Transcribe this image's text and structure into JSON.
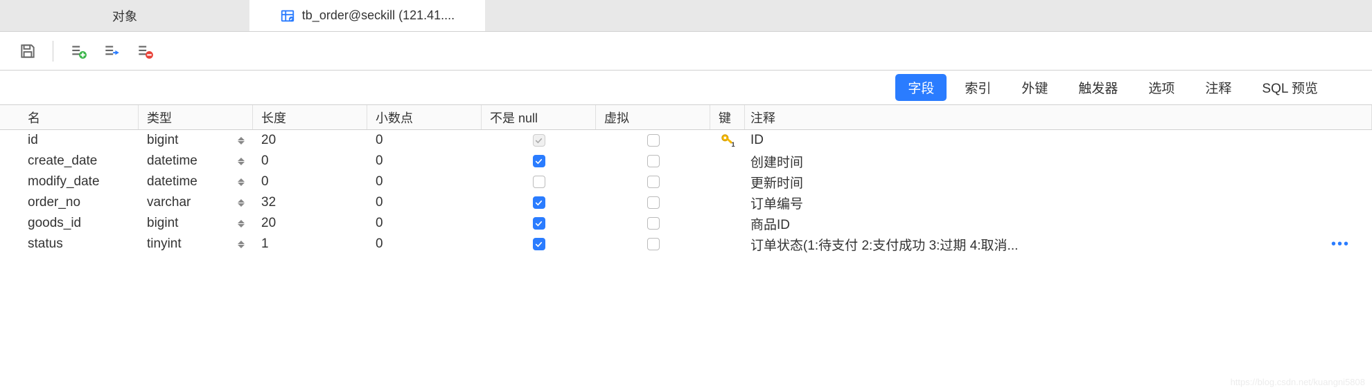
{
  "tabs": {
    "objects": "对象",
    "active": "tb_order@seckill (121.41...."
  },
  "subnav": {
    "items": [
      "字段",
      "索引",
      "外键",
      "触发器",
      "选项",
      "注释",
      "SQL 预览"
    ],
    "active_index": 0
  },
  "table": {
    "headers": {
      "name": "名",
      "type": "类型",
      "length": "长度",
      "decimal": "小数点",
      "not_null": "不是 null",
      "virtual": "虚拟",
      "key": "键",
      "comment": "注释"
    },
    "rows": [
      {
        "name": "id",
        "type": "bigint",
        "length": "20",
        "decimal": "0",
        "not_null": "disabled",
        "virtual": false,
        "key": true,
        "comment": "ID"
      },
      {
        "name": "create_date",
        "type": "datetime",
        "length": "0",
        "decimal": "0",
        "not_null": true,
        "virtual": false,
        "key": false,
        "comment": "创建时间"
      },
      {
        "name": "modify_date",
        "type": "datetime",
        "length": "0",
        "decimal": "0",
        "not_null": false,
        "virtual": false,
        "key": false,
        "comment": "更新时间"
      },
      {
        "name": "order_no",
        "type": "varchar",
        "length": "32",
        "decimal": "0",
        "not_null": true,
        "virtual": false,
        "key": false,
        "comment": "订单编号"
      },
      {
        "name": "goods_id",
        "type": "bigint",
        "length": "20",
        "decimal": "0",
        "not_null": true,
        "virtual": false,
        "key": false,
        "comment": "商品ID"
      },
      {
        "name": "status",
        "type": "tinyint",
        "length": "1",
        "decimal": "0",
        "not_null": true,
        "virtual": false,
        "key": false,
        "comment": "订单状态(1:待支付 2:支付成功 3:过期 4:取消...",
        "ellipsis": true
      }
    ]
  },
  "watermark": "https://blog.csdn.net/kuangni5808"
}
